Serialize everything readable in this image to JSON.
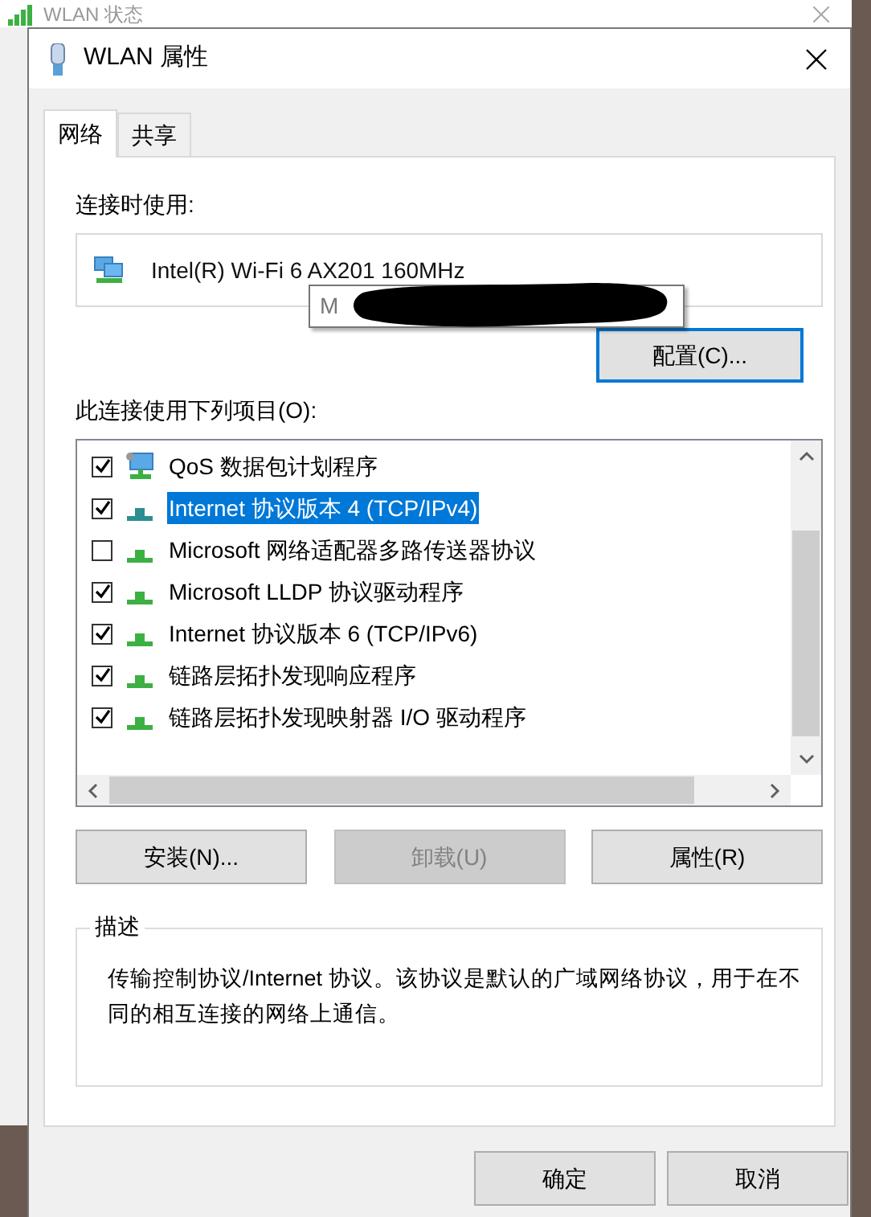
{
  "background_window": {
    "title": "WLAN 状态"
  },
  "dialog": {
    "title": "WLAN 属性"
  },
  "tabs": [
    {
      "label": "网络",
      "selected": true
    },
    {
      "label": "共享",
      "selected": false
    }
  ],
  "connect_using": {
    "label": "连接时使用:",
    "adapter": "Intel(R) Wi-Fi 6 AX201 160MHz",
    "tooltip": "M",
    "configure_button": "配置(C)..."
  },
  "items_label": "此连接使用下列项目(O):",
  "items": [
    {
      "label": "QoS 数据包计划程序",
      "checked": true,
      "selected": false,
      "kind": "service"
    },
    {
      "label": "Internet 协议版本 4 (TCP/IPv4)",
      "checked": true,
      "selected": true,
      "kind": "protocol"
    },
    {
      "label": "Microsoft 网络适配器多路传送器协议",
      "checked": false,
      "selected": false,
      "kind": "protocol"
    },
    {
      "label": "Microsoft LLDP 协议驱动程序",
      "checked": true,
      "selected": false,
      "kind": "protocol"
    },
    {
      "label": "Internet 协议版本 6 (TCP/IPv6)",
      "checked": true,
      "selected": false,
      "kind": "protocol"
    },
    {
      "label": "链路层拓扑发现响应程序",
      "checked": true,
      "selected": false,
      "kind": "protocol"
    },
    {
      "label": "链路层拓扑发现映射器 I/O 驱动程序",
      "checked": true,
      "selected": false,
      "kind": "protocol"
    }
  ],
  "buttons": [
    {
      "label": "安装(N)...",
      "disabled": false
    },
    {
      "label": "卸载(U)",
      "disabled": true
    },
    {
      "label": "属性(R)",
      "disabled": false
    }
  ],
  "description": {
    "title": "描述",
    "text": "传输控制协议/Internet 协议。该协议是默认的广域网络协议，用于在不同的相互连接的网络上通信。"
  },
  "footer_buttons": [
    "确定",
    "取消"
  ]
}
